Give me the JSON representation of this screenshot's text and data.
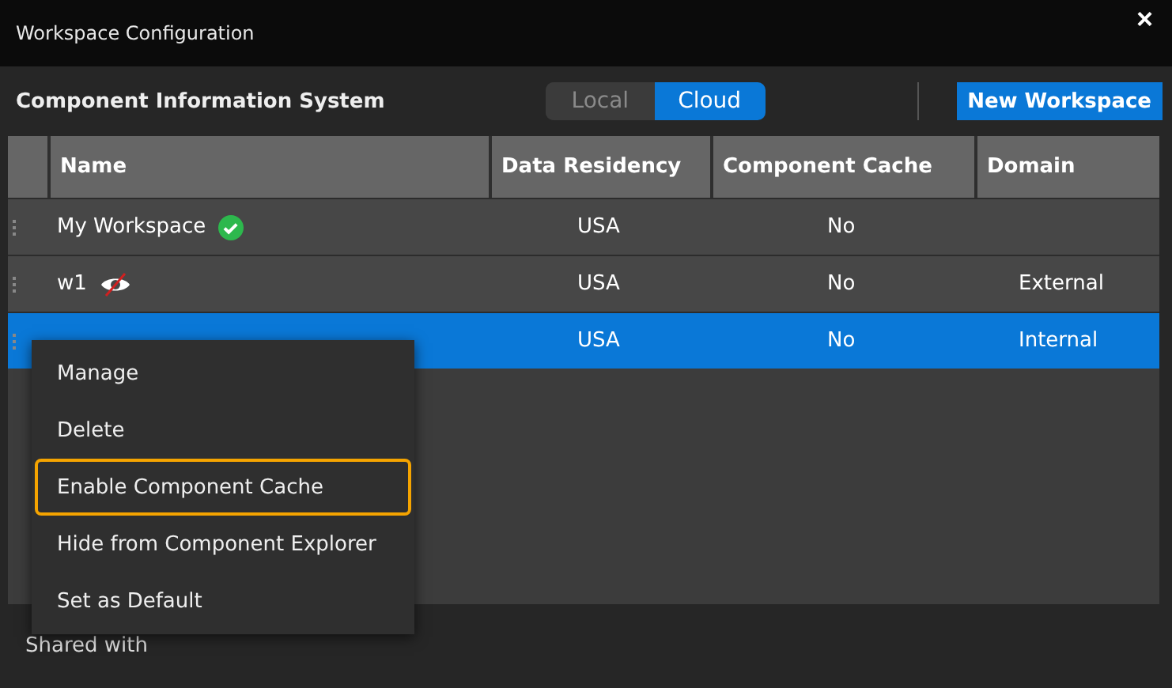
{
  "window": {
    "title": "Workspace Configuration",
    "close": "×"
  },
  "header": {
    "label": "Component Information System",
    "toggle": [
      {
        "label": "Local",
        "selected": false
      },
      {
        "label": "Cloud",
        "selected": true
      }
    ],
    "new_button": "New Workspace"
  },
  "table": {
    "columns": [
      "Name",
      "Data Residency",
      "Component Cache",
      "Domain"
    ],
    "rows": [
      {
        "name": "My Workspace",
        "kind": "check",
        "residency": "USA",
        "cache": "No",
        "selected": false
      },
      {
        "name": "w1",
        "kind": "hidden",
        "residency": "USA",
        "cache": "No",
        "domain": "External",
        "selected": false
      },
      {
        "kind": "plain",
        "residency": "USA",
        "cache": "No",
        "domain": "Internal",
        "selected": true
      }
    ]
  },
  "context_menu": {
    "items": [
      {
        "label": "Manage",
        "highlighted": false
      },
      {
        "label": "Delete",
        "highlighted": false
      },
      {
        "label": "Enable Component Cache",
        "highlighted": true
      },
      {
        "label": "Hide from Component Explorer",
        "highlighted": false
      },
      {
        "label": "Set as Default",
        "highlighted": false
      }
    ]
  },
  "footer": {
    "label": "Shared with"
  }
}
